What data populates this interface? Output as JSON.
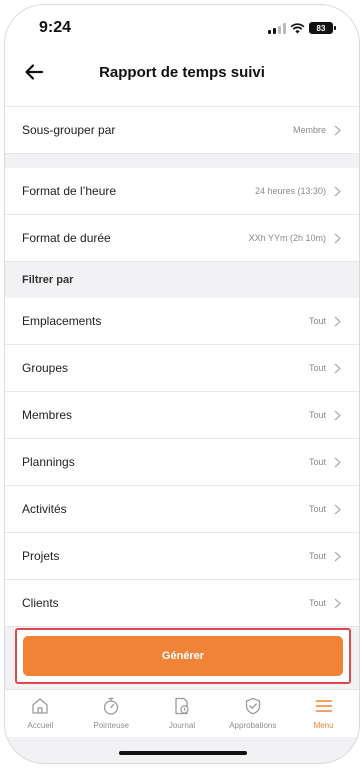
{
  "status_bar": {
    "time": "9:24",
    "battery": "83"
  },
  "nav": {
    "title": "Rapport de temps suivi"
  },
  "rows_top": [
    {
      "label": "Sous-grouper par",
      "value": "Membre"
    }
  ],
  "rows_format": [
    {
      "label": "Format de l’heure",
      "value": "24 heures (13:30)"
    },
    {
      "label": "Format de durée",
      "value": "XXh YYm (2h 10m)"
    }
  ],
  "filter_section": {
    "title": "Filtrer par"
  },
  "rows_filter": [
    {
      "label": "Emplacements",
      "value": "Tout"
    },
    {
      "label": "Groupes",
      "value": "Tout"
    },
    {
      "label": "Membres",
      "value": "Tout"
    },
    {
      "label": "Plannings",
      "value": "Tout"
    },
    {
      "label": "Activités",
      "value": "Tout"
    },
    {
      "label": "Projets",
      "value": "Tout"
    },
    {
      "label": "Clients",
      "value": "Tout"
    }
  ],
  "generate": {
    "label": "Générer"
  },
  "tabs": [
    {
      "label": "Accueil",
      "icon": "home-icon",
      "active": false
    },
    {
      "label": "Pointeuse",
      "icon": "stopwatch-icon",
      "active": false
    },
    {
      "label": "Journal",
      "icon": "timesheet-icon",
      "active": false
    },
    {
      "label": "Approbations",
      "icon": "shield-check-icon",
      "active": false
    },
    {
      "label": "Menu",
      "icon": "menu-icon",
      "active": true
    }
  ],
  "colors": {
    "accent": "#f08338",
    "highlight_border": "#e0474c",
    "background": "#f2f2f5"
  }
}
